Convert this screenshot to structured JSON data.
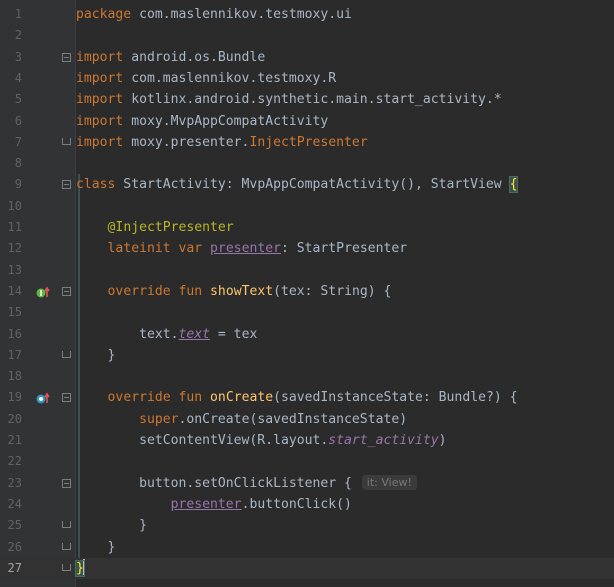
{
  "editor": {
    "current_line": 27,
    "colors": {
      "background": "#2b2b2b",
      "gutter": "#313335",
      "keyword": "#cc7832",
      "annotation": "#bbb529",
      "property": "#9876aa",
      "function": "#ffc66d",
      "text": "#a9b7c6"
    },
    "gutter_icons": [
      {
        "line": 14,
        "name": "implements-method-icon"
      },
      {
        "line": 19,
        "name": "overrides-method-icon"
      }
    ],
    "inlay_hint": "it: View!",
    "lines": [
      {
        "number": "1",
        "tokens": [
          {
            "t": "package",
            "c": "kw"
          },
          {
            "t": " com.maslennikov.testmoxy.ui"
          }
        ]
      },
      {
        "number": "2",
        "tokens": []
      },
      {
        "number": "3",
        "tokens": [
          {
            "t": "import",
            "c": "kw"
          },
          {
            "t": " android.os.Bundle"
          }
        ]
      },
      {
        "number": "4",
        "tokens": [
          {
            "t": "import",
            "c": "kw"
          },
          {
            "t": " com.maslennikov.testmoxy.R"
          }
        ]
      },
      {
        "number": "5",
        "tokens": [
          {
            "t": "import",
            "c": "kw"
          },
          {
            "t": " kotlinx.android.synthetic.main.start_activity.*"
          }
        ]
      },
      {
        "number": "6",
        "tokens": [
          {
            "t": "import",
            "c": "kw"
          },
          {
            "t": " moxy.MvpAppCompatActivity"
          }
        ]
      },
      {
        "number": "7",
        "tokens": [
          {
            "t": "import",
            "c": "kw"
          },
          {
            "t": " moxy.presenter."
          },
          {
            "t": "InjectPresenter",
            "c": "kw"
          }
        ]
      },
      {
        "number": "8",
        "tokens": []
      },
      {
        "number": "9",
        "tokens": [
          {
            "t": "class",
            "c": "kw"
          },
          {
            "t": " StartActivity: MvpAppCompatActivity(), StartView "
          },
          {
            "t": "{",
            "c": "brace-hl"
          }
        ]
      },
      {
        "number": "10",
        "tokens": []
      },
      {
        "number": "11",
        "tokens": [
          {
            "t": "    "
          },
          {
            "t": "@InjectPresenter",
            "c": "ann"
          }
        ]
      },
      {
        "number": "12",
        "tokens": [
          {
            "t": "    "
          },
          {
            "t": "lateinit var",
            "c": "kw"
          },
          {
            "t": " "
          },
          {
            "t": "presenter",
            "c": "prop ul"
          },
          {
            "t": ": StartPresenter"
          }
        ]
      },
      {
        "number": "13",
        "tokens": []
      },
      {
        "number": "14",
        "tokens": [
          {
            "t": "    "
          },
          {
            "t": "override fun",
            "c": "kw"
          },
          {
            "t": " "
          },
          {
            "t": "showText",
            "c": "fn"
          },
          {
            "t": "(tex: String) {"
          }
        ]
      },
      {
        "number": "15",
        "tokens": []
      },
      {
        "number": "16",
        "tokens": [
          {
            "t": "        text."
          },
          {
            "t": "text",
            "c": "prop it ul"
          },
          {
            "t": " = tex"
          }
        ]
      },
      {
        "number": "17",
        "tokens": [
          {
            "t": "    }"
          }
        ]
      },
      {
        "number": "18",
        "tokens": []
      },
      {
        "number": "19",
        "tokens": [
          {
            "t": "    "
          },
          {
            "t": "override fun",
            "c": "kw"
          },
          {
            "t": " "
          },
          {
            "t": "onCreate",
            "c": "fn"
          },
          {
            "t": "(savedInstanceState: Bundle?) {"
          }
        ]
      },
      {
        "number": "20",
        "tokens": [
          {
            "t": "        "
          },
          {
            "t": "super",
            "c": "kw"
          },
          {
            "t": ".onCreate(savedInstanceState)"
          }
        ]
      },
      {
        "number": "21",
        "tokens": [
          {
            "t": "        setContentView(R.layout."
          },
          {
            "t": "start_activity",
            "c": "prop it"
          },
          {
            "t": ")"
          }
        ]
      },
      {
        "number": "22",
        "tokens": []
      },
      {
        "number": "23",
        "tokens": [
          {
            "t": "        button.setOnClickListener { "
          },
          {
            "t": "it: View!",
            "c": "hint"
          }
        ]
      },
      {
        "number": "24",
        "tokens": [
          {
            "t": "            "
          },
          {
            "t": "presenter",
            "c": "prop ul"
          },
          {
            "t": ".buttonClick()"
          }
        ]
      },
      {
        "number": "25",
        "tokens": [
          {
            "t": "        }"
          }
        ]
      },
      {
        "number": "26",
        "tokens": [
          {
            "t": "    }"
          }
        ]
      },
      {
        "number": "27",
        "tokens": [
          {
            "t": "}",
            "c": "brace-hl"
          }
        ]
      }
    ]
  }
}
